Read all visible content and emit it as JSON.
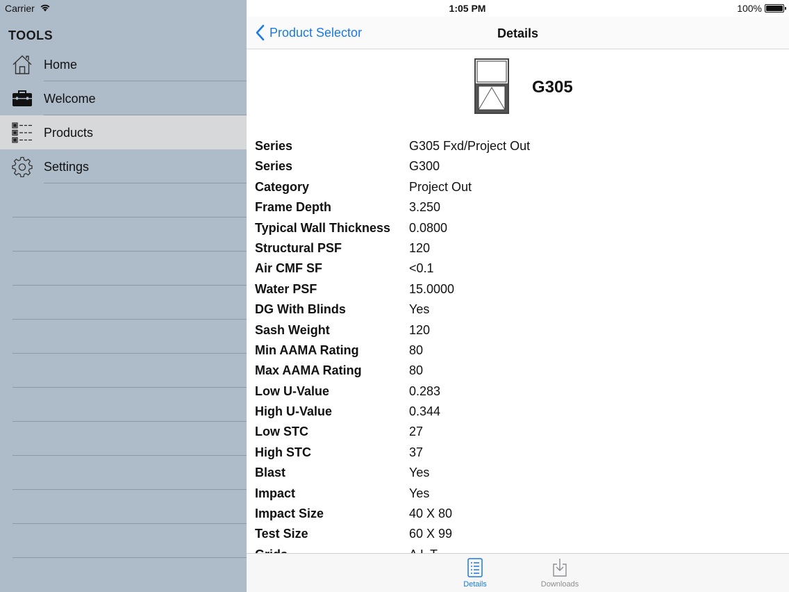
{
  "status_bar": {
    "carrier": "Carrier",
    "time": "1:05 PM",
    "battery": "100%"
  },
  "sidebar": {
    "title": "TOOLS",
    "items": [
      {
        "label": "Home",
        "icon": "home-icon"
      },
      {
        "label": "Welcome",
        "icon": "briefcase-icon"
      },
      {
        "label": "Products",
        "icon": "list-icon",
        "selected": true
      },
      {
        "label": "Settings",
        "icon": "gear-icon"
      }
    ]
  },
  "navbar": {
    "back_label": "Product Selector",
    "title": "Details"
  },
  "product": {
    "name": "G305",
    "image_icon": "window-icon"
  },
  "details": [
    {
      "key": "Series",
      "value": "G305 Fxd/Project Out"
    },
    {
      "key": "Series",
      "value": "G300"
    },
    {
      "key": "Category",
      "value": "Project Out"
    },
    {
      "key": "Frame Depth",
      "value": "3.250"
    },
    {
      "key": "Typical Wall Thickness",
      "value": "0.0800"
    },
    {
      "key": "Structural PSF",
      "value": "120"
    },
    {
      "key": "Air CMF SF",
      "value": "<0.1"
    },
    {
      "key": "Water PSF",
      "value": "15.0000"
    },
    {
      "key": "DG With Blinds",
      "value": "Yes"
    },
    {
      "key": "Sash Weight",
      "value": "120"
    },
    {
      "key": "Min AAMA Rating",
      "value": "80"
    },
    {
      "key": "Max AAMA Rating",
      "value": "80"
    },
    {
      "key": "Low U-Value",
      "value": "0.283"
    },
    {
      "key": "High U-Value",
      "value": "0.344"
    },
    {
      "key": "Low STC",
      "value": "27"
    },
    {
      "key": "High STC",
      "value": "37"
    },
    {
      "key": "Blast",
      "value": "Yes"
    },
    {
      "key": "Impact",
      "value": "Yes"
    },
    {
      "key": "Impact Size",
      "value": "40 X 80"
    },
    {
      "key": "Test Size",
      "value": "60 X 99"
    },
    {
      "key": "Grids",
      "value": "A L T"
    }
  ],
  "tabbar": {
    "tabs": [
      {
        "label": "Details",
        "icon": "details-list-icon",
        "active": true
      },
      {
        "label": "Downloads",
        "icon": "download-icon",
        "active": false
      }
    ]
  },
  "colors": {
    "accent": "#1a7ae0",
    "sidebar_bg": "#aebbc8",
    "sidebar_selected": "#d6d8da"
  }
}
